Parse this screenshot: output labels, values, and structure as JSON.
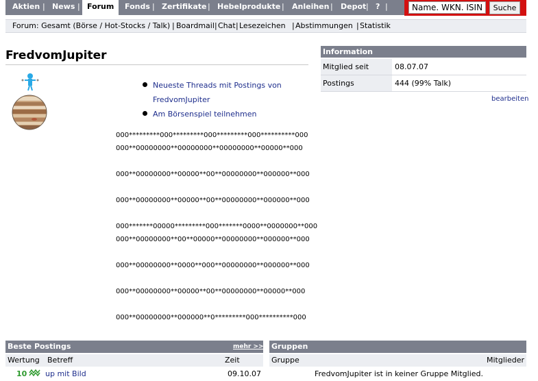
{
  "nav": {
    "tabs": [
      "Aktien",
      "News",
      "Forum",
      "Fonds",
      "Zertifikate",
      "Hebelprodukte",
      "Anleihen",
      "Depot",
      "?"
    ],
    "active": "Forum",
    "search_placeholder": "Name. WKN. ISIN",
    "search_button": "Suche"
  },
  "subnav": {
    "items": [
      "Forum: Gesamt (Börse / Hot-Stocks / Talk)",
      "Boardmail",
      "Chat",
      "Lesezeichen",
      "Abstimmungen",
      "Statistik"
    ]
  },
  "profile": {
    "name": "FredvomJupiter",
    "link_threads_line1": "Neueste Threads mit Postings von",
    "link_threads_line2": "FredvomJupiter",
    "link_game": "Am Börsenspiel teilnehmen"
  },
  "art_lines": [
    "000*********000*********000*********000**********000",
    "000**00000000**00000000**00000000**00000**000",
    "000**00000000**00000**00**00000000**000000**000",
    "000**00000000**00000**00**00000000**000000**000",
    "000*******00000*********000*******0000**0000000**000",
    "000**00000000**00**00000**00000000**000000**000",
    "000**00000000**0000**000**00000000**000000**000",
    "000**00000000**00000**00**00000000**00000**000",
    "000**00000000**000000**0*********000**********000"
  ],
  "info": {
    "header": "Information",
    "rows": [
      {
        "key": "Mitglied seit",
        "value": "08.07.07"
      },
      {
        "key": "Postings",
        "value": "444 (99% Talk)"
      }
    ],
    "edit": "bearbeiten"
  },
  "best_postings": {
    "header": "Beste Postings",
    "more": "mehr >>",
    "columns": [
      "Wertung",
      "Betreff",
      "Zeit"
    ],
    "rows": [
      {
        "rating": "10",
        "subject": "up mit Bild",
        "time": "09.10.07"
      }
    ]
  },
  "groups": {
    "header": "Gruppen",
    "columns": [
      "Gruppe",
      "Mitglieder"
    ],
    "empty": "FredvomJupiter ist in keiner Gruppe Mitglied."
  }
}
